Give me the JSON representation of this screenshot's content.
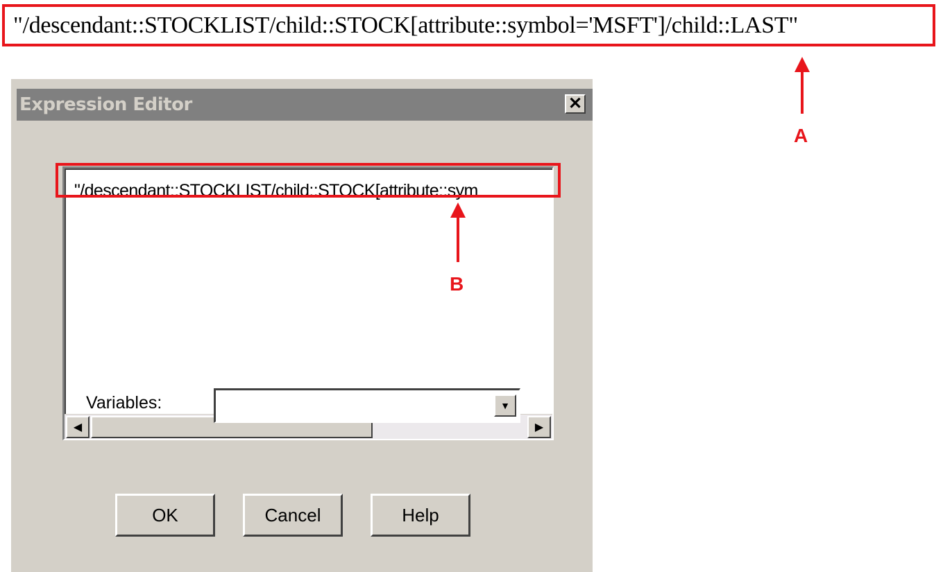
{
  "callout_top": {
    "text": "\"/descendant::STOCKLIST/child::STOCK[attribute::symbol='MSFT']/child::LAST\"",
    "marker": "A"
  },
  "dialog": {
    "title": "Expression Editor",
    "close_glyph": "✕",
    "editor": {
      "visible_text": "\"/descendant::STOCKLIST/child::STOCK[attribute::sym",
      "marker": "B",
      "scroll_left_glyph": "◀",
      "scroll_right_glyph": "▶"
    },
    "variables": {
      "label": "Variables:",
      "value": "",
      "dropdown_glyph": "▼"
    },
    "buttons": {
      "ok": "OK",
      "cancel": "Cancel",
      "help": "Help"
    }
  },
  "colors": {
    "annotation_red": "#e8151b",
    "dialog_face": "#d4d0c8",
    "titlebar_inactive": "#808080"
  },
  "icons": {
    "close": "close-icon",
    "scroll_left": "arrow-left-icon",
    "scroll_right": "arrow-right-icon",
    "dropdown": "chevron-down-icon"
  }
}
